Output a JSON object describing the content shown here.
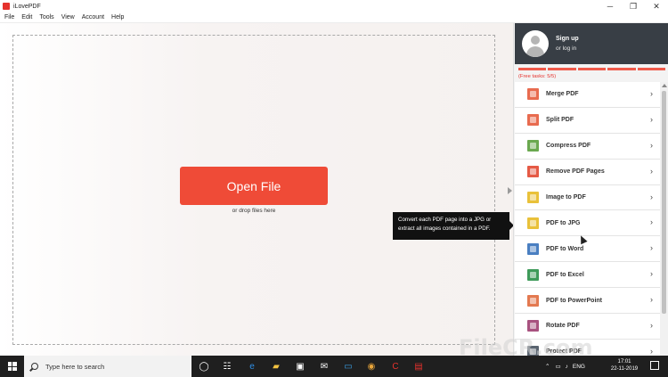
{
  "window": {
    "title": "iLovePDF",
    "minimize_icon": "minimize-icon",
    "maximize_icon": "maximize-icon",
    "close_icon": "close-icon"
  },
  "menu": [
    "File",
    "Edit",
    "Tools",
    "View",
    "Account",
    "Help"
  ],
  "main": {
    "open_button": "Open File",
    "drop_hint": "or drop files here",
    "open_button_color": "#ef4b37"
  },
  "tooltip": {
    "text": "Convert each PDF page into a JPG or extract all images contained in a PDF."
  },
  "sidebar": {
    "signup": "Sign up",
    "login": "or log in",
    "free_tasks": "(Free tasks: 5/5)",
    "task_segments": 5,
    "accent": "#e5322d",
    "tools": [
      {
        "label": "Merge PDF",
        "icon": "merge-pdf-icon",
        "color": "#e86b4f"
      },
      {
        "label": "Split PDF",
        "icon": "split-pdf-icon",
        "color": "#e86b4f"
      },
      {
        "label": "Compress PDF",
        "icon": "compress-pdf-icon",
        "color": "#6aa84f"
      },
      {
        "label": "Remove PDF Pages",
        "icon": "remove-pages-icon",
        "color": "#e55a45"
      },
      {
        "label": "Image to PDF",
        "icon": "image-to-pdf-icon",
        "color": "#e9c13a"
      },
      {
        "label": "PDF to JPG",
        "icon": "pdf-to-jpg-icon",
        "color": "#e9c13a"
      },
      {
        "label": "PDF to Word",
        "icon": "pdf-to-word-icon",
        "color": "#4a7fc1"
      },
      {
        "label": "PDF to Excel",
        "icon": "pdf-to-excel-icon",
        "color": "#3f9b5a"
      },
      {
        "label": "PDF to PowerPoint",
        "icon": "pdf-to-powerpoint-icon",
        "color": "#e37950"
      },
      {
        "label": "Rotate PDF",
        "icon": "rotate-pdf-icon",
        "color": "#a8527f"
      },
      {
        "label": "Protect PDF",
        "icon": "protect-pdf-icon",
        "color": "#5a6470"
      }
    ]
  },
  "taskbar": {
    "search_placeholder": "Type here to search",
    "language": "ENG",
    "time": "17:01",
    "date": "22-11-2019",
    "pinned_icons": [
      "task-view-icon",
      "timeline-icon",
      "edge-icon",
      "file-explorer-icon",
      "store-icon",
      "mail-icon",
      "chat-icon",
      "chrome-icon",
      "ccleaner-icon",
      "ilovepdf-taskbar-icon"
    ]
  },
  "watermark": "FileCR.com"
}
